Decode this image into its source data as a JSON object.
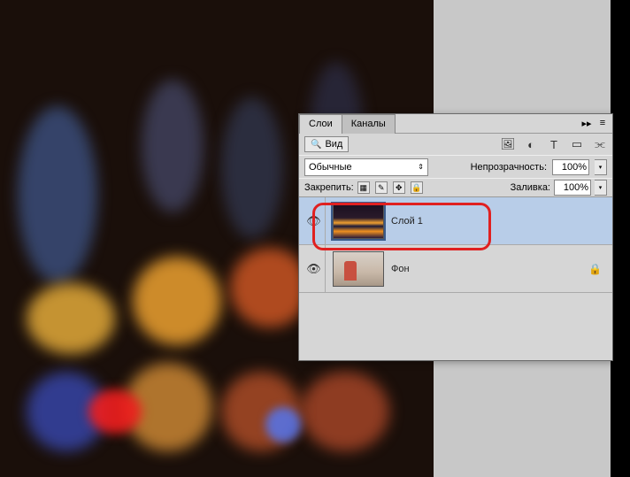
{
  "tabs": {
    "layers": "Слои",
    "channels": "Каналы"
  },
  "search": {
    "label": "Вид"
  },
  "blend": {
    "mode": "Обычные"
  },
  "opacity": {
    "label": "Непрозрачность:",
    "value": "100%"
  },
  "lock": {
    "label": "Закрепить:"
  },
  "fill": {
    "label": "Заливка:",
    "value": "100%"
  },
  "layers": [
    {
      "name": "Слой 1",
      "locked": false
    },
    {
      "name": "Фон",
      "locked": true
    }
  ],
  "icons": {
    "collapse": "▸▸",
    "menu": "≡",
    "magnifier": "🔍",
    "image": "🖼",
    "adjust": "◐",
    "type": "T",
    "mask": "▭",
    "link": "⫘",
    "eye": "👁",
    "lock": "🔒",
    "move": "✥",
    "brush": "✎",
    "pixel": "▦",
    "chevdown": "▾",
    "updown": "⇕"
  }
}
